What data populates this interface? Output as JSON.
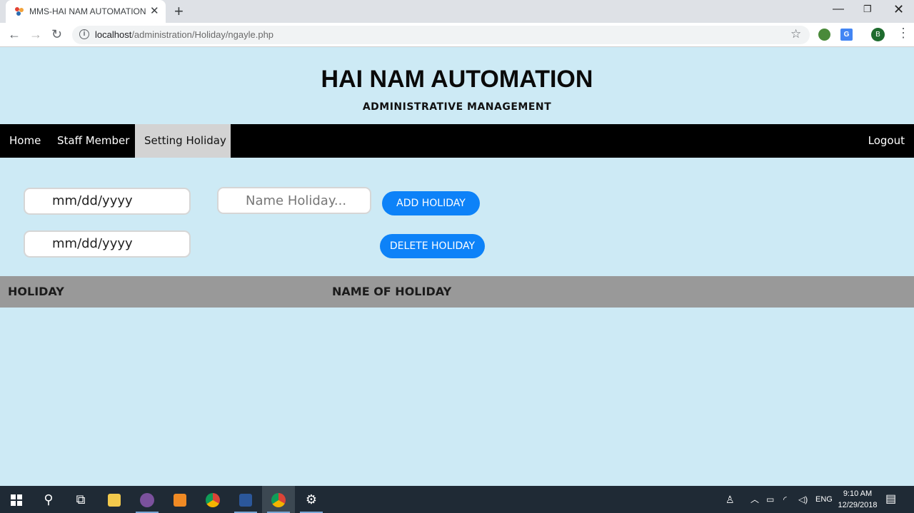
{
  "browser": {
    "tab_title": "MMS-HAI NAM AUTOMATION",
    "url_host": "localhost",
    "url_path": "/administration/Holiday/ngayle.php",
    "profile_initial": "B"
  },
  "header": {
    "title": "HAI NAM AUTOMATION",
    "subtitle": "ADMINISTRATIVE MANAGEMENT"
  },
  "nav": {
    "home": "Home",
    "staff": "Staff Member",
    "setting": "Setting Holiday",
    "logout": "Logout"
  },
  "form": {
    "date_from": "mm/dd/yyyy",
    "date_to": "mm/dd/yyyy",
    "name_placeholder": "Name Holiday...",
    "add_label": "ADD HOLIDAY",
    "delete_label": "DELETE HOLIDAY"
  },
  "table": {
    "columns": [
      "HOLIDAY",
      "NAME OF HOLIDAY"
    ],
    "rows": []
  },
  "taskbar": {
    "lang": "ENG",
    "time": "9:10 AM",
    "date": "12/29/2018"
  },
  "colors": {
    "page_bg": "#cdeaf5",
    "navbar": "#000000",
    "active_nav": "#d3d3d3",
    "button": "#0d82f8",
    "table_header": "#999999"
  },
  "icons": [
    "favicon-icon",
    "close-icon",
    "plus-icon",
    "back-icon",
    "forward-icon",
    "reload-icon",
    "info-icon",
    "star-icon",
    "extension-icon",
    "translate-icon",
    "menu-icon",
    "windows-start-icon",
    "search-icon",
    "task-view-icon",
    "file-explorer-icon",
    "viber-icon",
    "sublime-icon",
    "chrome-icon",
    "word-icon",
    "settings-icon",
    "people-icon",
    "chevron-up-icon",
    "battery-icon",
    "wifi-icon",
    "volume-icon",
    "notification-icon"
  ]
}
